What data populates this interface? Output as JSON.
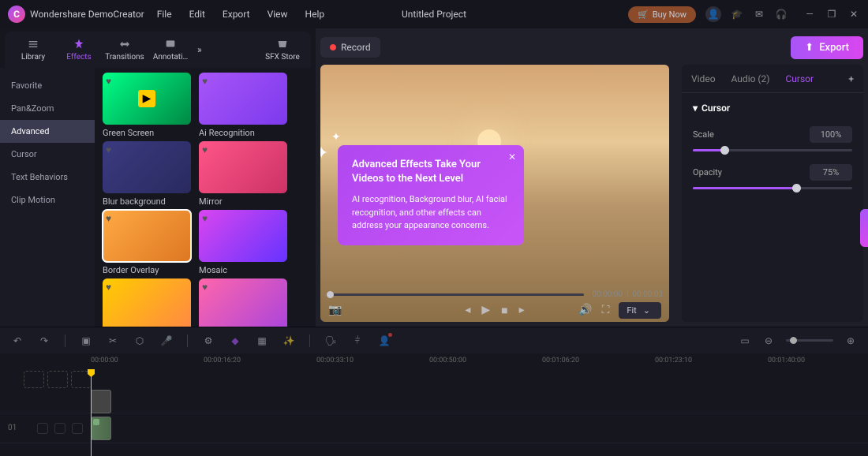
{
  "app": {
    "title": "Wondershare DemoCreator"
  },
  "menu": {
    "file": "File",
    "edit": "Edit",
    "export": "Export",
    "view": "View",
    "help": "Help"
  },
  "project": {
    "name": "Untitled Project"
  },
  "titlebar": {
    "buy_now": "Buy Now"
  },
  "tabs": {
    "library": "Library",
    "effects": "Effects",
    "transitions": "Transitions",
    "annotations": "Annotati…",
    "sfx": "SFX Store"
  },
  "categories": {
    "favorite": "Favorite",
    "pan_zoom": "Pan&Zoom",
    "advanced": "Advanced",
    "cursor": "Cursor",
    "text_behaviors": "Text Behaviors",
    "clip_motion": "Clip Motion"
  },
  "effects": {
    "green_screen": "Green Screen",
    "ai_recognition": "Ai Recognition",
    "blur_background": "Blur background",
    "mirror": "Mirror",
    "border_overlay": "Border Overlay",
    "mosaic": "Mosaic"
  },
  "buttons": {
    "record": "Record",
    "export": "Export"
  },
  "tooltip": {
    "title": "Advanced Effects Take Your Videos to the Next Level",
    "body": "AI recognition, Background blur, AI facial recognition, and other effects can address your appearance concerns."
  },
  "preview": {
    "time_current": "00:00:00",
    "time_total": "00:00:03",
    "fit": "Fit"
  },
  "properties": {
    "tabs": {
      "video": "Video",
      "audio": "Audio (2)",
      "cursor": "Cursor"
    },
    "section": "Cursor",
    "scale": {
      "label": "Scale",
      "value": "100%",
      "percent": 20
    },
    "opacity": {
      "label": "Opacity",
      "value": "75%",
      "percent": 65
    }
  },
  "timeline": {
    "marks": [
      "00:00:00",
      "00:00:16:20",
      "00:00:33:10",
      "00:00:50:00",
      "00:01:06:20",
      "00:01:23:10",
      "00:01:40:00"
    ],
    "track_num": "01"
  }
}
